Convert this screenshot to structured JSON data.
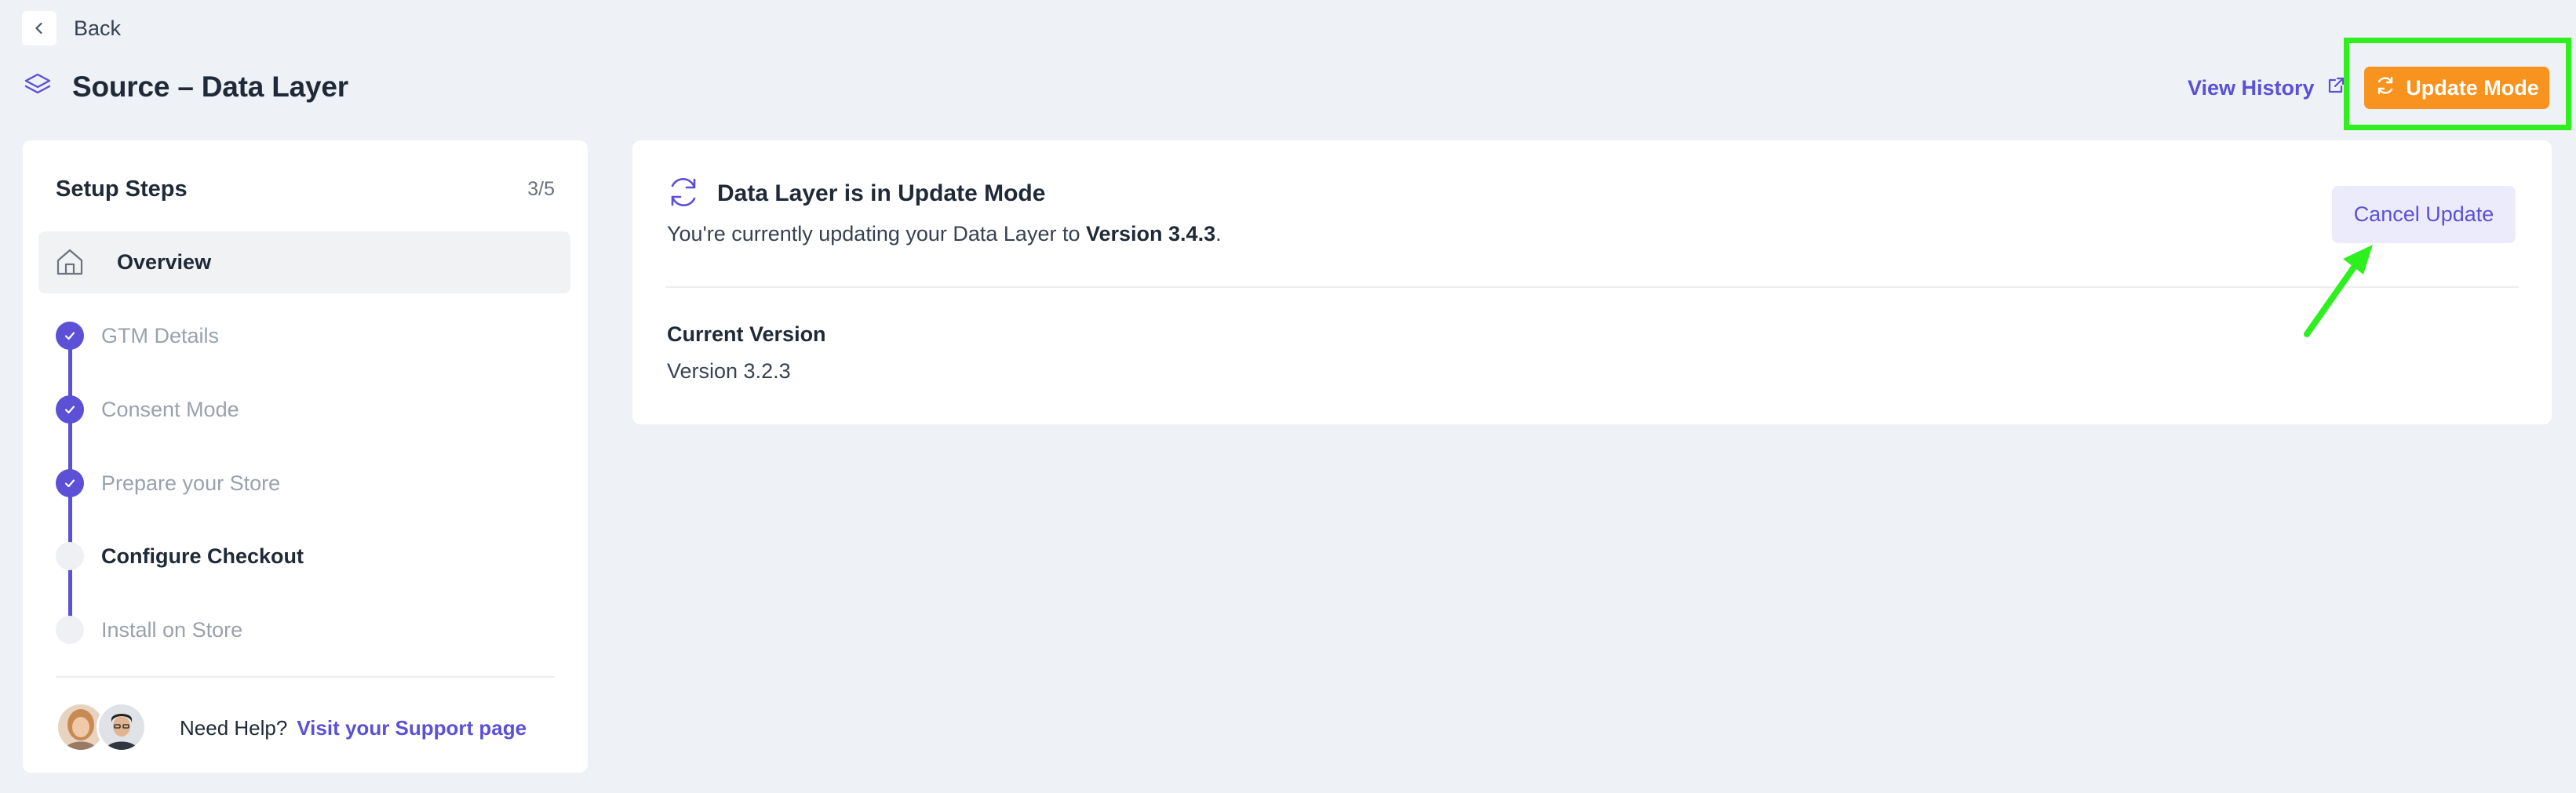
{
  "nav": {
    "back_label": "Back"
  },
  "header": {
    "title": "Source – Data Layer",
    "view_history_label": "View History",
    "update_mode_label": "Update Mode"
  },
  "sidebar": {
    "title": "Setup Steps",
    "progress": "3/5",
    "steps": [
      {
        "label": "Overview",
        "state": "selected"
      },
      {
        "label": "GTM Details",
        "state": "completed"
      },
      {
        "label": "Consent Mode",
        "state": "completed"
      },
      {
        "label": "Prepare your Store",
        "state": "completed"
      },
      {
        "label": "Configure Checkout",
        "state": "current"
      },
      {
        "label": "Install on Store",
        "state": "pending"
      }
    ],
    "help": {
      "text": "Need Help?",
      "link_label": "Visit your Support page"
    }
  },
  "main": {
    "title": "Data Layer is in Update Mode",
    "desc_prefix": "You're currently updating your Data Layer to ",
    "target_version": "Version 3.4.3",
    "desc_suffix": ".",
    "cancel_label": "Cancel Update",
    "current_version_label": "Current Version",
    "current_version_value": "Version 3.2.3"
  },
  "colors": {
    "accent": "#5b50d6",
    "update_button": "#f7931e",
    "highlight": "#2ef01f",
    "background": "#eef1f5"
  }
}
